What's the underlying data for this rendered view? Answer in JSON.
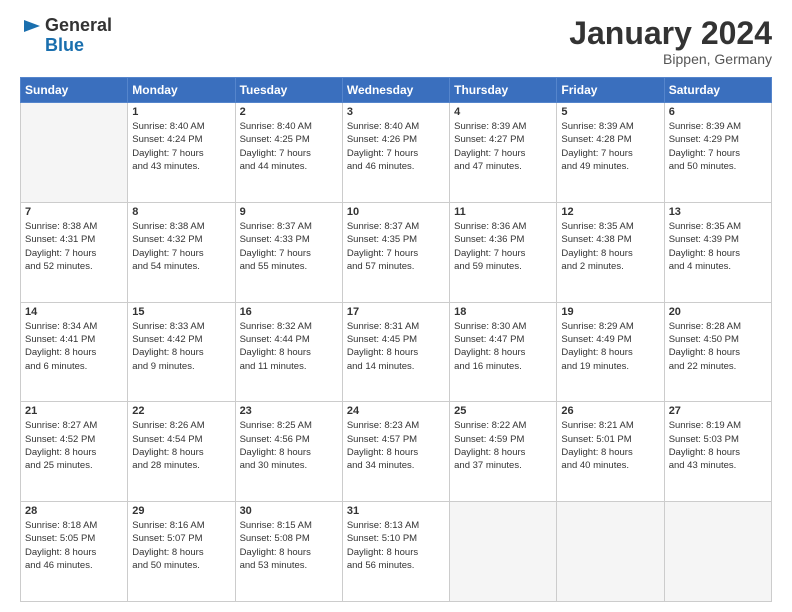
{
  "header": {
    "logo_general": "General",
    "logo_blue": "Blue",
    "title": "January 2024",
    "location": "Bippen, Germany"
  },
  "days_of_week": [
    "Sunday",
    "Monday",
    "Tuesday",
    "Wednesday",
    "Thursday",
    "Friday",
    "Saturday"
  ],
  "weeks": [
    [
      {
        "day": "",
        "info": ""
      },
      {
        "day": "1",
        "info": "Sunrise: 8:40 AM\nSunset: 4:24 PM\nDaylight: 7 hours\nand 43 minutes."
      },
      {
        "day": "2",
        "info": "Sunrise: 8:40 AM\nSunset: 4:25 PM\nDaylight: 7 hours\nand 44 minutes."
      },
      {
        "day": "3",
        "info": "Sunrise: 8:40 AM\nSunset: 4:26 PM\nDaylight: 7 hours\nand 46 minutes."
      },
      {
        "day": "4",
        "info": "Sunrise: 8:39 AM\nSunset: 4:27 PM\nDaylight: 7 hours\nand 47 minutes."
      },
      {
        "day": "5",
        "info": "Sunrise: 8:39 AM\nSunset: 4:28 PM\nDaylight: 7 hours\nand 49 minutes."
      },
      {
        "day": "6",
        "info": "Sunrise: 8:39 AM\nSunset: 4:29 PM\nDaylight: 7 hours\nand 50 minutes."
      }
    ],
    [
      {
        "day": "7",
        "info": "Sunrise: 8:38 AM\nSunset: 4:31 PM\nDaylight: 7 hours\nand 52 minutes."
      },
      {
        "day": "8",
        "info": "Sunrise: 8:38 AM\nSunset: 4:32 PM\nDaylight: 7 hours\nand 54 minutes."
      },
      {
        "day": "9",
        "info": "Sunrise: 8:37 AM\nSunset: 4:33 PM\nDaylight: 7 hours\nand 55 minutes."
      },
      {
        "day": "10",
        "info": "Sunrise: 8:37 AM\nSunset: 4:35 PM\nDaylight: 7 hours\nand 57 minutes."
      },
      {
        "day": "11",
        "info": "Sunrise: 8:36 AM\nSunset: 4:36 PM\nDaylight: 7 hours\nand 59 minutes."
      },
      {
        "day": "12",
        "info": "Sunrise: 8:35 AM\nSunset: 4:38 PM\nDaylight: 8 hours\nand 2 minutes."
      },
      {
        "day": "13",
        "info": "Sunrise: 8:35 AM\nSunset: 4:39 PM\nDaylight: 8 hours\nand 4 minutes."
      }
    ],
    [
      {
        "day": "14",
        "info": "Sunrise: 8:34 AM\nSunset: 4:41 PM\nDaylight: 8 hours\nand 6 minutes."
      },
      {
        "day": "15",
        "info": "Sunrise: 8:33 AM\nSunset: 4:42 PM\nDaylight: 8 hours\nand 9 minutes."
      },
      {
        "day": "16",
        "info": "Sunrise: 8:32 AM\nSunset: 4:44 PM\nDaylight: 8 hours\nand 11 minutes."
      },
      {
        "day": "17",
        "info": "Sunrise: 8:31 AM\nSunset: 4:45 PM\nDaylight: 8 hours\nand 14 minutes."
      },
      {
        "day": "18",
        "info": "Sunrise: 8:30 AM\nSunset: 4:47 PM\nDaylight: 8 hours\nand 16 minutes."
      },
      {
        "day": "19",
        "info": "Sunrise: 8:29 AM\nSunset: 4:49 PM\nDaylight: 8 hours\nand 19 minutes."
      },
      {
        "day": "20",
        "info": "Sunrise: 8:28 AM\nSunset: 4:50 PM\nDaylight: 8 hours\nand 22 minutes."
      }
    ],
    [
      {
        "day": "21",
        "info": "Sunrise: 8:27 AM\nSunset: 4:52 PM\nDaylight: 8 hours\nand 25 minutes."
      },
      {
        "day": "22",
        "info": "Sunrise: 8:26 AM\nSunset: 4:54 PM\nDaylight: 8 hours\nand 28 minutes."
      },
      {
        "day": "23",
        "info": "Sunrise: 8:25 AM\nSunset: 4:56 PM\nDaylight: 8 hours\nand 30 minutes."
      },
      {
        "day": "24",
        "info": "Sunrise: 8:23 AM\nSunset: 4:57 PM\nDaylight: 8 hours\nand 34 minutes."
      },
      {
        "day": "25",
        "info": "Sunrise: 8:22 AM\nSunset: 4:59 PM\nDaylight: 8 hours\nand 37 minutes."
      },
      {
        "day": "26",
        "info": "Sunrise: 8:21 AM\nSunset: 5:01 PM\nDaylight: 8 hours\nand 40 minutes."
      },
      {
        "day": "27",
        "info": "Sunrise: 8:19 AM\nSunset: 5:03 PM\nDaylight: 8 hours\nand 43 minutes."
      }
    ],
    [
      {
        "day": "28",
        "info": "Sunrise: 8:18 AM\nSunset: 5:05 PM\nDaylight: 8 hours\nand 46 minutes."
      },
      {
        "day": "29",
        "info": "Sunrise: 8:16 AM\nSunset: 5:07 PM\nDaylight: 8 hours\nand 50 minutes."
      },
      {
        "day": "30",
        "info": "Sunrise: 8:15 AM\nSunset: 5:08 PM\nDaylight: 8 hours\nand 53 minutes."
      },
      {
        "day": "31",
        "info": "Sunrise: 8:13 AM\nSunset: 5:10 PM\nDaylight: 8 hours\nand 56 minutes."
      },
      {
        "day": "",
        "info": ""
      },
      {
        "day": "",
        "info": ""
      },
      {
        "day": "",
        "info": ""
      }
    ]
  ]
}
